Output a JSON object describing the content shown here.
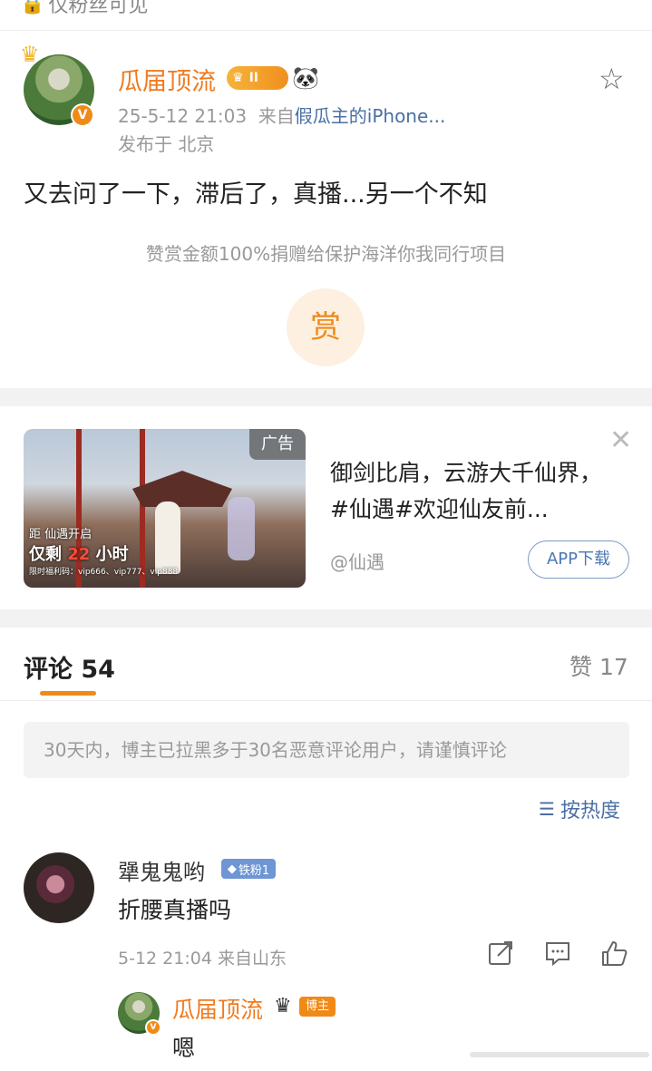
{
  "topbar": {
    "visibility_label": "仅粉丝可见",
    "visibility_icon": "lock-icon"
  },
  "post": {
    "author": "瓜届顶流",
    "level_badge": "II",
    "verified_badge": "V",
    "timestamp": "25-5-12 21:03",
    "source_prefix": "来自",
    "source": "假瓜主的iPhone...",
    "location": "发布于 北京",
    "content": "又去问了一下，滞后了，真播...另一个不知",
    "reward_note": "赞赏金额100%捐赠给保护海洋你我同行项目",
    "reward_button": "赏"
  },
  "ad": {
    "tag": "广告",
    "banner_line1": "距 仙遇开启",
    "banner_line2_prefix": "仅剩",
    "banner_line2_num": "22",
    "banner_line2_suffix": "小时",
    "banner_line3": "限时福利码：vip666、vip777、vip888",
    "title": "御剑比肩，云游大千仙界，#仙遇#欢迎仙友前...",
    "account": "@仙遇",
    "download_button": "APP下载"
  },
  "comments_section": {
    "tab_comments": "评论 54",
    "tab_likes": "赞 17",
    "notice": "30天内，博主已拉黑多于30名恶意评论用户，请谨慎评论",
    "sort_label": "按热度"
  },
  "comments": [
    {
      "author": "犟鬼鬼哟",
      "badge": "铁粉1",
      "text": "折腰真播吗",
      "meta": "5-12 21:04  来自山东",
      "reply": {
        "author": "瓜届顶流",
        "badge": "博主",
        "verified_badge": "V",
        "text": "嗯"
      }
    }
  ],
  "colors": {
    "accent": "#f08a17",
    "link": "#4a6fa5",
    "name": "#f07b1f"
  }
}
